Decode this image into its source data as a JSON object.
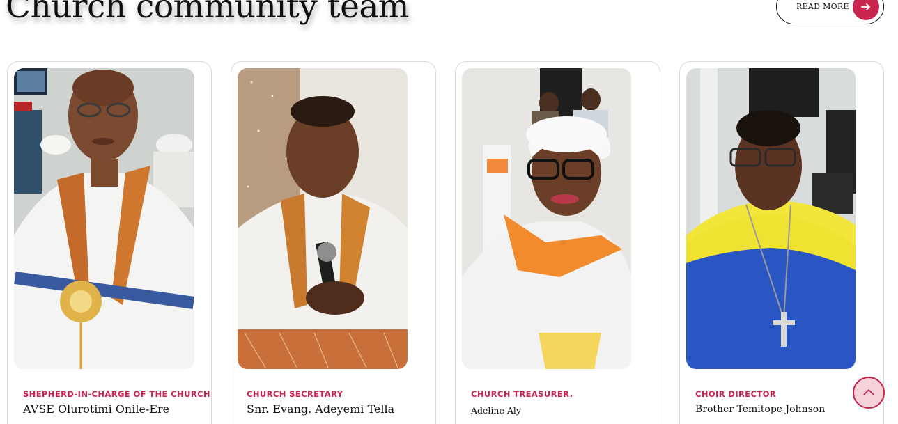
{
  "section": {
    "title": "Church community team",
    "read_more_label": "READ MORE"
  },
  "colors": {
    "accent": "#c8254e",
    "scroll_top_bg": "#f6d3da",
    "text": "#111111"
  },
  "team": [
    {
      "role": "SHEPHERD-IN-CHARGE OF THE CHURCH",
      "name": "AVSE Olurotimi Onile-Ere"
    },
    {
      "role": "CHURCH SECRETARY",
      "name": "Snr. Evang. Adeyemi Tella"
    },
    {
      "role": "CHURCH TREASURER.",
      "name": "Adeline Aly"
    },
    {
      "role": "CHOIR DIRECTOR",
      "name": "Brother Temitope Johnson"
    }
  ],
  "icons": {
    "read_more": "arrow-right-icon",
    "scroll_top": "chevron-up-icon"
  }
}
